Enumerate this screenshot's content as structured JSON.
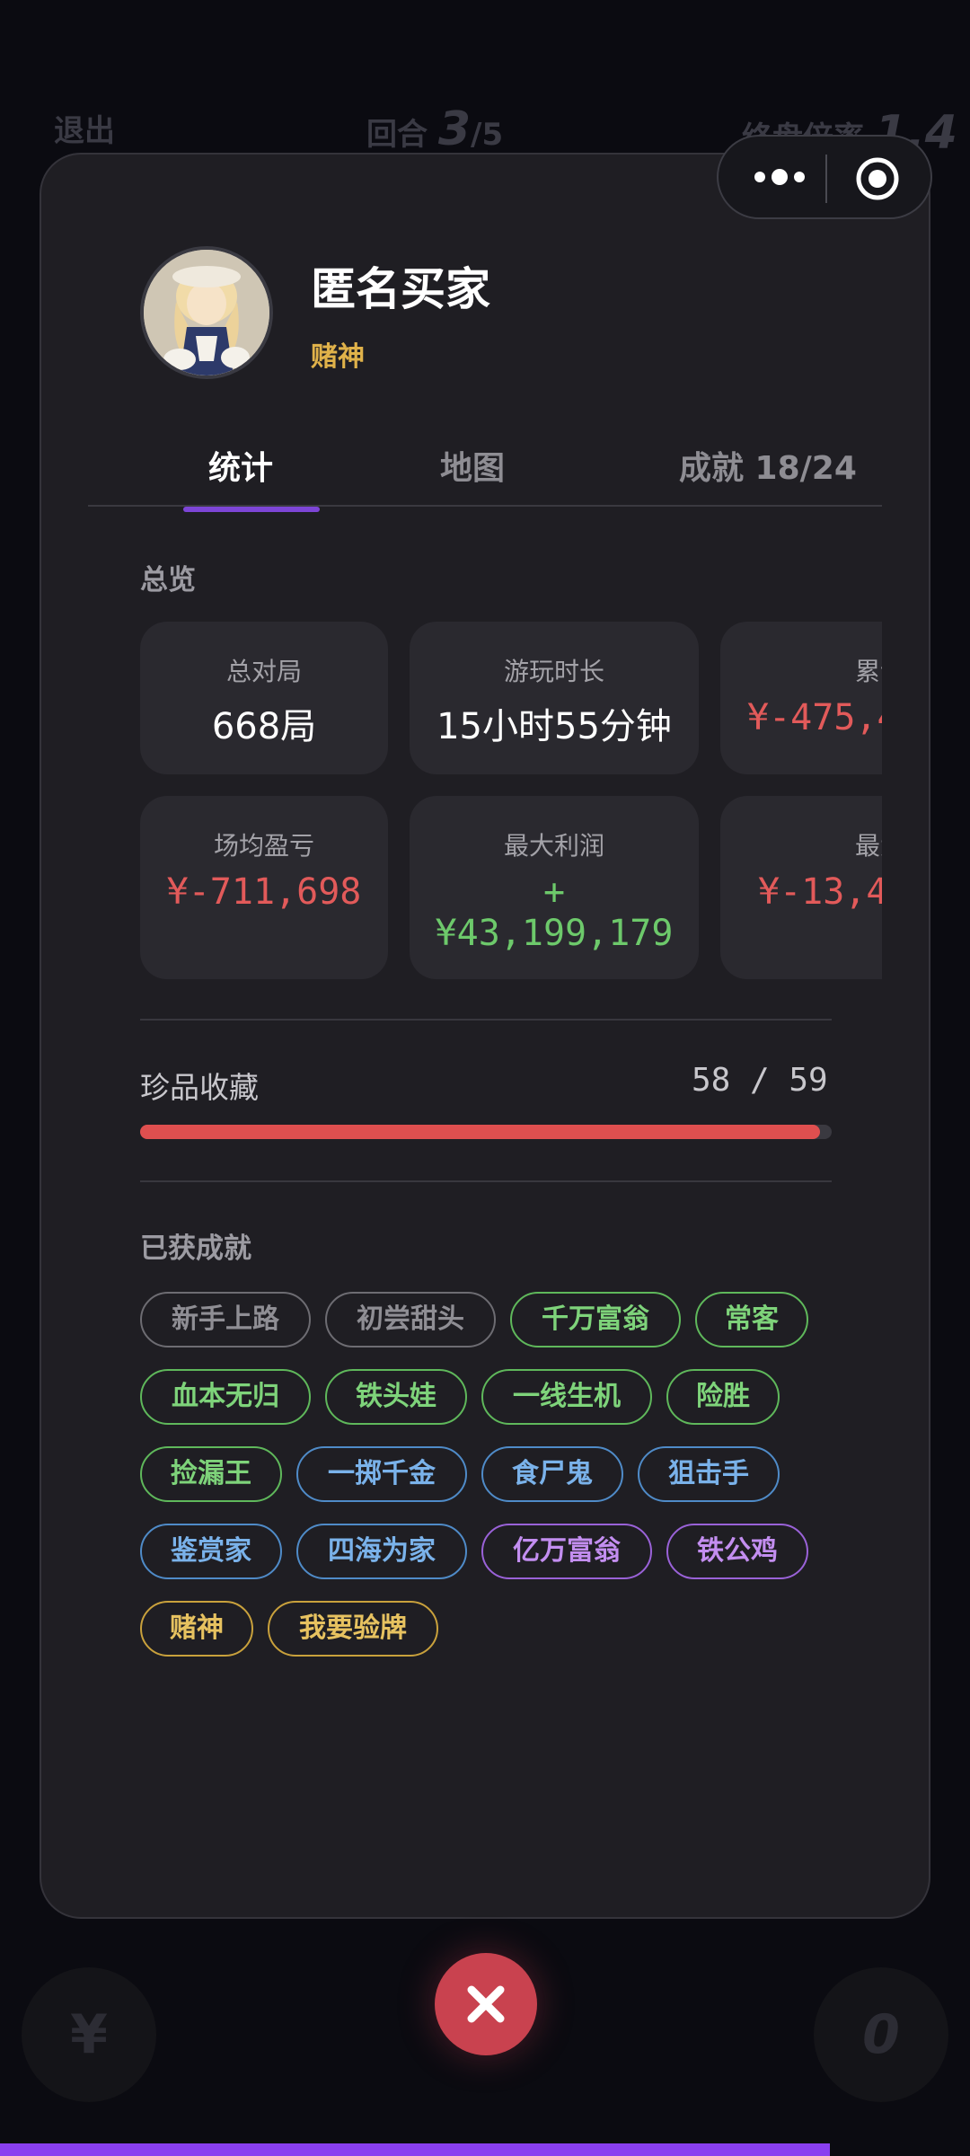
{
  "background": {
    "left_label": "退出",
    "round_label": "回合",
    "round_current": "3",
    "round_total": "/5",
    "right_label": "终盘倍率",
    "right_value": "1.4",
    "bottom_left_symbol": "¥",
    "bottom_right_symbol": "0"
  },
  "profile": {
    "name": "匿名买家",
    "title": "赌神"
  },
  "tabs": [
    {
      "label": "统计",
      "active": true
    },
    {
      "label": "地图",
      "active": false
    },
    {
      "label": "成就 18/24",
      "active": false
    }
  ],
  "overview": {
    "section_title": "总览",
    "cards": [
      {
        "label": "总对局",
        "value": "668局",
        "color": "white"
      },
      {
        "label": "游玩时长",
        "value": "15小时55分钟",
        "color": "white"
      },
      {
        "label": "累计",
        "value": "¥-475,4",
        "color": "red"
      },
      {
        "label": "场均盈亏",
        "value": "¥-711,698",
        "color": "red"
      },
      {
        "label": "最大利润",
        "value_line1": "+",
        "value_line2": "¥43,199,179",
        "color": "green"
      },
      {
        "label": "最大",
        "value": "¥-13,4",
        "color": "red"
      }
    ]
  },
  "collection": {
    "label": "珍品收藏",
    "count_text": "58 / 59",
    "collected": 58,
    "total": 59
  },
  "achievements": {
    "section_title": "已获成就",
    "badges": [
      {
        "label": "新手上路",
        "tier": "gray"
      },
      {
        "label": "初尝甜头",
        "tier": "gray"
      },
      {
        "label": "千万富翁",
        "tier": "green"
      },
      {
        "label": "常客",
        "tier": "green"
      },
      {
        "label": "血本无归",
        "tier": "green"
      },
      {
        "label": "铁头娃",
        "tier": "green"
      },
      {
        "label": "一线生机",
        "tier": "green"
      },
      {
        "label": "险胜",
        "tier": "green"
      },
      {
        "label": "捡漏王",
        "tier": "green"
      },
      {
        "label": "一掷千金",
        "tier": "blue"
      },
      {
        "label": "食尸鬼",
        "tier": "blue"
      },
      {
        "label": "狙击手",
        "tier": "blue"
      },
      {
        "label": "鉴赏家",
        "tier": "blue"
      },
      {
        "label": "四海为家",
        "tier": "blue"
      },
      {
        "label": "亿万富翁",
        "tier": "purple"
      },
      {
        "label": "铁公鸡",
        "tier": "purple"
      },
      {
        "label": "赌神",
        "tier": "gold"
      },
      {
        "label": "我要验牌",
        "tier": "gold"
      }
    ]
  },
  "colors": {
    "accent": "#7d45d6",
    "loss": "#e25a5a",
    "profit": "#6dc96b",
    "title_gold": "#e0b24a",
    "close_button": "#c9424f"
  },
  "icons": {
    "menu": "more-dots-icon",
    "target": "target-icon",
    "close": "close-icon"
  }
}
